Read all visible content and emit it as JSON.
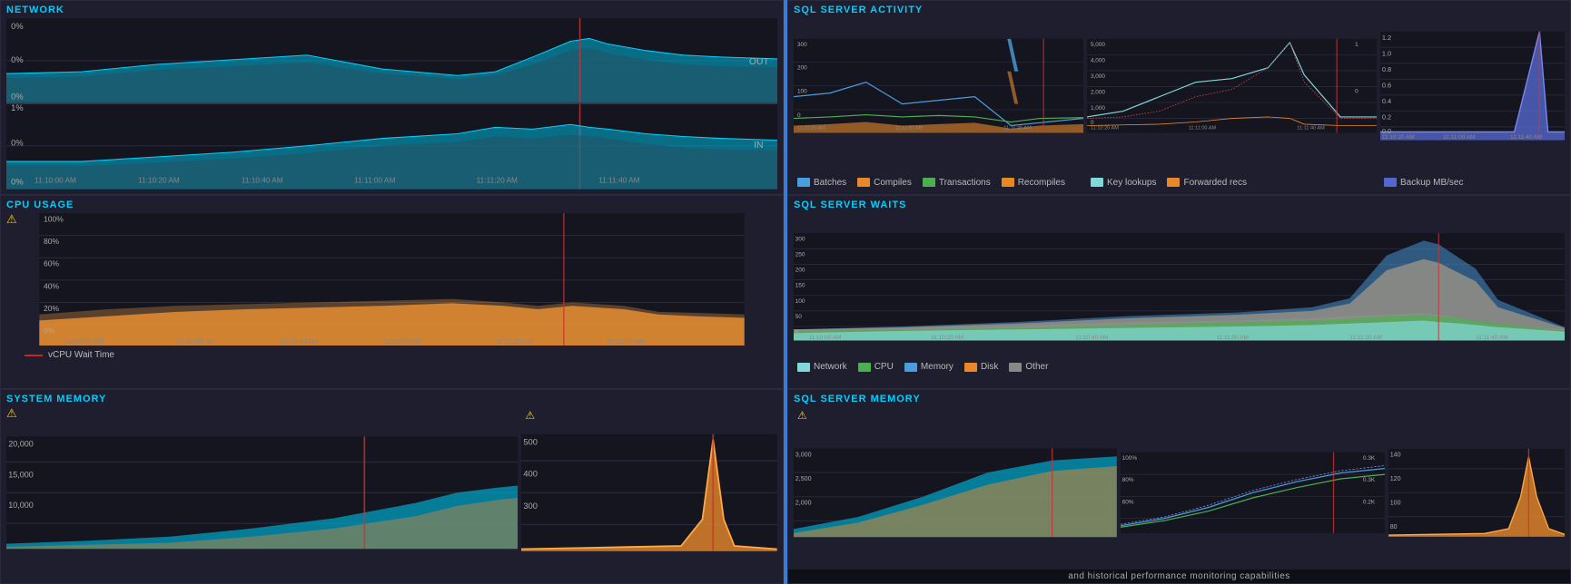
{
  "panels": {
    "network": {
      "title": "NETWORK",
      "labels": {
        "out": "OUT",
        "in": "IN"
      },
      "y_labels_out": [
        "0%",
        "0%",
        "0%"
      ],
      "y_labels_in": [
        "1%",
        "0%",
        "0%"
      ],
      "x_labels": [
        "11:10:00 AM",
        "11:10:20 AM",
        "11:10:40 AM",
        "11:11:00 AM",
        "11:11:20 AM",
        "11:11:40 AM"
      ]
    },
    "cpu_usage": {
      "title": "CPU USAGE",
      "y_labels": [
        "100%",
        "80%",
        "60%",
        "40%",
        "20%",
        "0%"
      ],
      "x_labels": [
        "11:10:00 AM",
        "11:10:20 AM",
        "11:10:40 AM",
        "11:11:00 AM",
        "11:11:20 AM",
        "11:11:40 AM"
      ],
      "legend": [
        {
          "label": "vCPU Wait Time",
          "color": "#cc2222"
        }
      ]
    },
    "system_memory": {
      "title": "SYSTEM MEMORY",
      "y_labels_left": [
        "20,000",
        "15,000",
        "10,000"
      ],
      "y_labels_right": [
        "500",
        "400",
        "300"
      ],
      "warning": true
    },
    "sql_activity": {
      "title": "SQL SERVER ACTIVITY",
      "sub1": {
        "y_labels": [
          "300",
          "200",
          "100",
          "0"
        ],
        "x_labels": [
          "11:10:20 AM",
          "11:11:00 AM",
          "11:11:40 AM"
        ]
      },
      "sub2": {
        "y_labels": [
          "5,000",
          "4,000",
          "3,000",
          "2,000",
          "1,000",
          "0"
        ],
        "x_labels": [
          "11:10:20 AM",
          "11:11:00 AM",
          "11:11:40 AM"
        ],
        "y2_labels": [
          "1",
          "0"
        ]
      },
      "sub3": {
        "y_labels": [
          "1.2",
          "1.0",
          "0.8",
          "0.6",
          "0.4",
          "0.2",
          "0.0"
        ],
        "x_labels": [
          "11:10:20 AM",
          "11:11:00 AM",
          "11:11:40 AM"
        ]
      },
      "legend": [
        {
          "label": "Batches",
          "color": "#4a9edd"
        },
        {
          "label": "Compiles",
          "color": "#e8884a"
        },
        {
          "label": "Transactions",
          "color": "#4caf50"
        },
        {
          "label": "Recompiles",
          "color": "#e88820"
        },
        {
          "label": "Key lookups",
          "color": "#80d8d8"
        },
        {
          "label": "Forwarded recs",
          "color": "#e8882a"
        },
        {
          "label": "Backup MB/sec",
          "color": "#5566cc"
        }
      ]
    },
    "sql_waits": {
      "title": "SQL SERVER WAITS",
      "y_labels": [
        "300",
        "250",
        "200",
        "150",
        "100",
        "50",
        "0"
      ],
      "x_labels": [
        "11:10:00 AM",
        "11:10:20 AM",
        "11:10:40 AM",
        "11:11:00 AM",
        "11:11:20 AM",
        "11:11:40 AM"
      ],
      "legend": [
        {
          "label": "Network",
          "color": "#80d8d8"
        },
        {
          "label": "CPU",
          "color": "#4caf50"
        },
        {
          "label": "Memory",
          "color": "#4a9edd"
        },
        {
          "label": "Disk",
          "color": "#e8882a"
        },
        {
          "label": "Other",
          "color": "#888888"
        }
      ]
    },
    "sql_memory": {
      "title": "SQL SERVER MEMORY",
      "sub1": {
        "y_labels": [
          "3,000",
          "2,500",
          "2,000"
        ],
        "warning": true
      },
      "sub2": {
        "y_labels": [
          "100%",
          "80%",
          "60%"
        ],
        "y2_labels": [
          "0.3K",
          "0.3K",
          "0.2K"
        ]
      },
      "sub3": {
        "y_labels": [
          "140",
          "120",
          "100",
          "80"
        ]
      },
      "bottom_text": "and historical performance monitoring capabilities"
    }
  },
  "colors": {
    "cyan_fill": "#00aacc",
    "cyan_stroke": "#00cfff",
    "orange_fill": "#e8882a",
    "orange_stroke": "#ff9933",
    "blue_fill": "#4a9edd",
    "green_fill": "#4caf50",
    "red_line": "#cc2222",
    "gray_fill": "#888888",
    "teal_fill": "#80d8d8",
    "accent_blue": "#3a7bd5",
    "warning_yellow": "#ffcc00",
    "panel_bg": "#1e1e2e",
    "grid_line": "#2a2a3e",
    "chart_bg": "#151520"
  }
}
